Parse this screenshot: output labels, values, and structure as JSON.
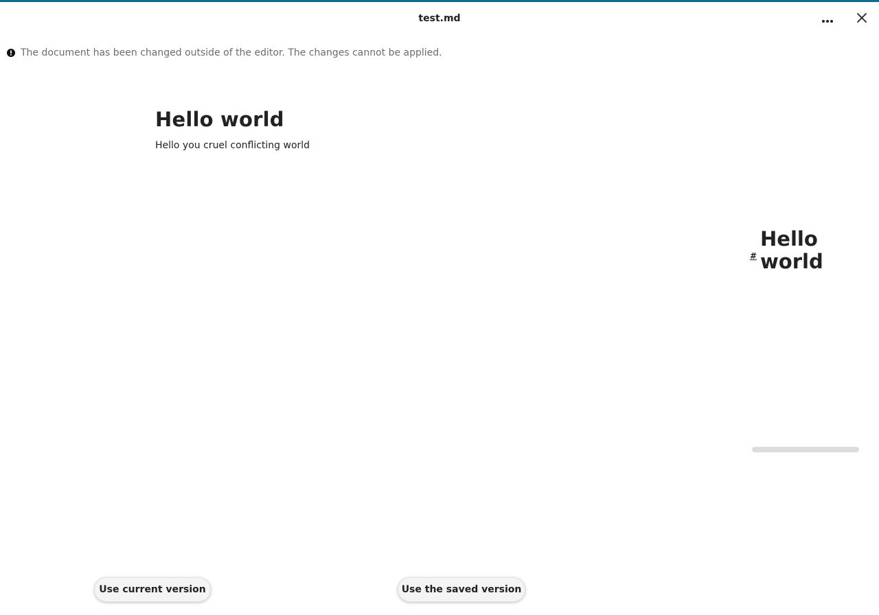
{
  "window": {
    "title": "test.md",
    "accent_color": "#0f6c8c"
  },
  "header": {
    "more_icon": "ellipsis-icon",
    "close_icon": "close-icon"
  },
  "notice": {
    "icon": "exclamation-circle-icon",
    "text": "The document has been changed outside of the editor. The changes cannot be applied."
  },
  "document": {
    "heading": "Hello world",
    "paragraph": "Hello you cruel conflicting world"
  },
  "preview": {
    "anchor": "#",
    "heading": "Hello world"
  },
  "actions": {
    "use_current": "Use current version",
    "use_saved": "Use the saved version"
  }
}
